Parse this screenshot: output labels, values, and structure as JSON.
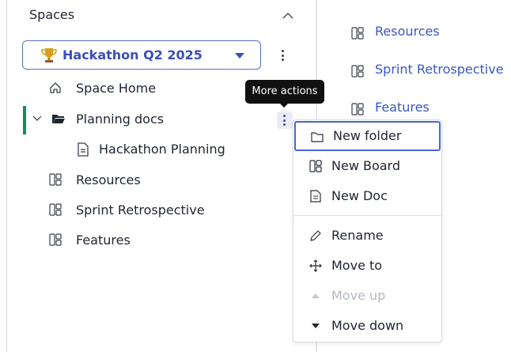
{
  "sidebar": {
    "spaces_title": "Spaces",
    "space_selector": {
      "name": "Hackathon Q2 2025",
      "icon": "trophy-icon"
    },
    "tooltip": "More actions",
    "tree": [
      {
        "label": "Space Home",
        "icon": "home-icon"
      },
      {
        "label": "Planning docs",
        "icon": "folder-open-icon",
        "expanded": true,
        "active": true
      },
      {
        "label": "Hackathon Planning",
        "icon": "doc-icon",
        "child": true
      },
      {
        "label": "Resources",
        "icon": "board-icon"
      },
      {
        "label": "Sprint Retrospective",
        "icon": "board-icon"
      },
      {
        "label": "Features",
        "icon": "board-icon"
      }
    ]
  },
  "content": {
    "links": [
      {
        "label": "Resources",
        "icon": "board-icon"
      },
      {
        "label": "Sprint Retrospective",
        "icon": "board-icon"
      },
      {
        "label": "Features",
        "icon": "board-icon"
      }
    ]
  },
  "context_menu": {
    "items": [
      {
        "label": "New folder",
        "icon": "folder-icon",
        "focused": true
      },
      {
        "label": "New Board",
        "icon": "board-icon"
      },
      {
        "label": "New Doc",
        "icon": "doc-icon"
      },
      {
        "label": "Rename",
        "icon": "pencil-icon"
      },
      {
        "label": "Move to",
        "icon": "move-icon"
      },
      {
        "label": "Move up",
        "icon": "triangle-up-icon",
        "disabled": true
      },
      {
        "label": "Move down",
        "icon": "triangle-down-icon"
      }
    ]
  },
  "colors": {
    "accent": "#3b4fb8",
    "link": "#3b57c4",
    "active_bar": "#1e8a57",
    "tooltip_bg": "#111111"
  }
}
